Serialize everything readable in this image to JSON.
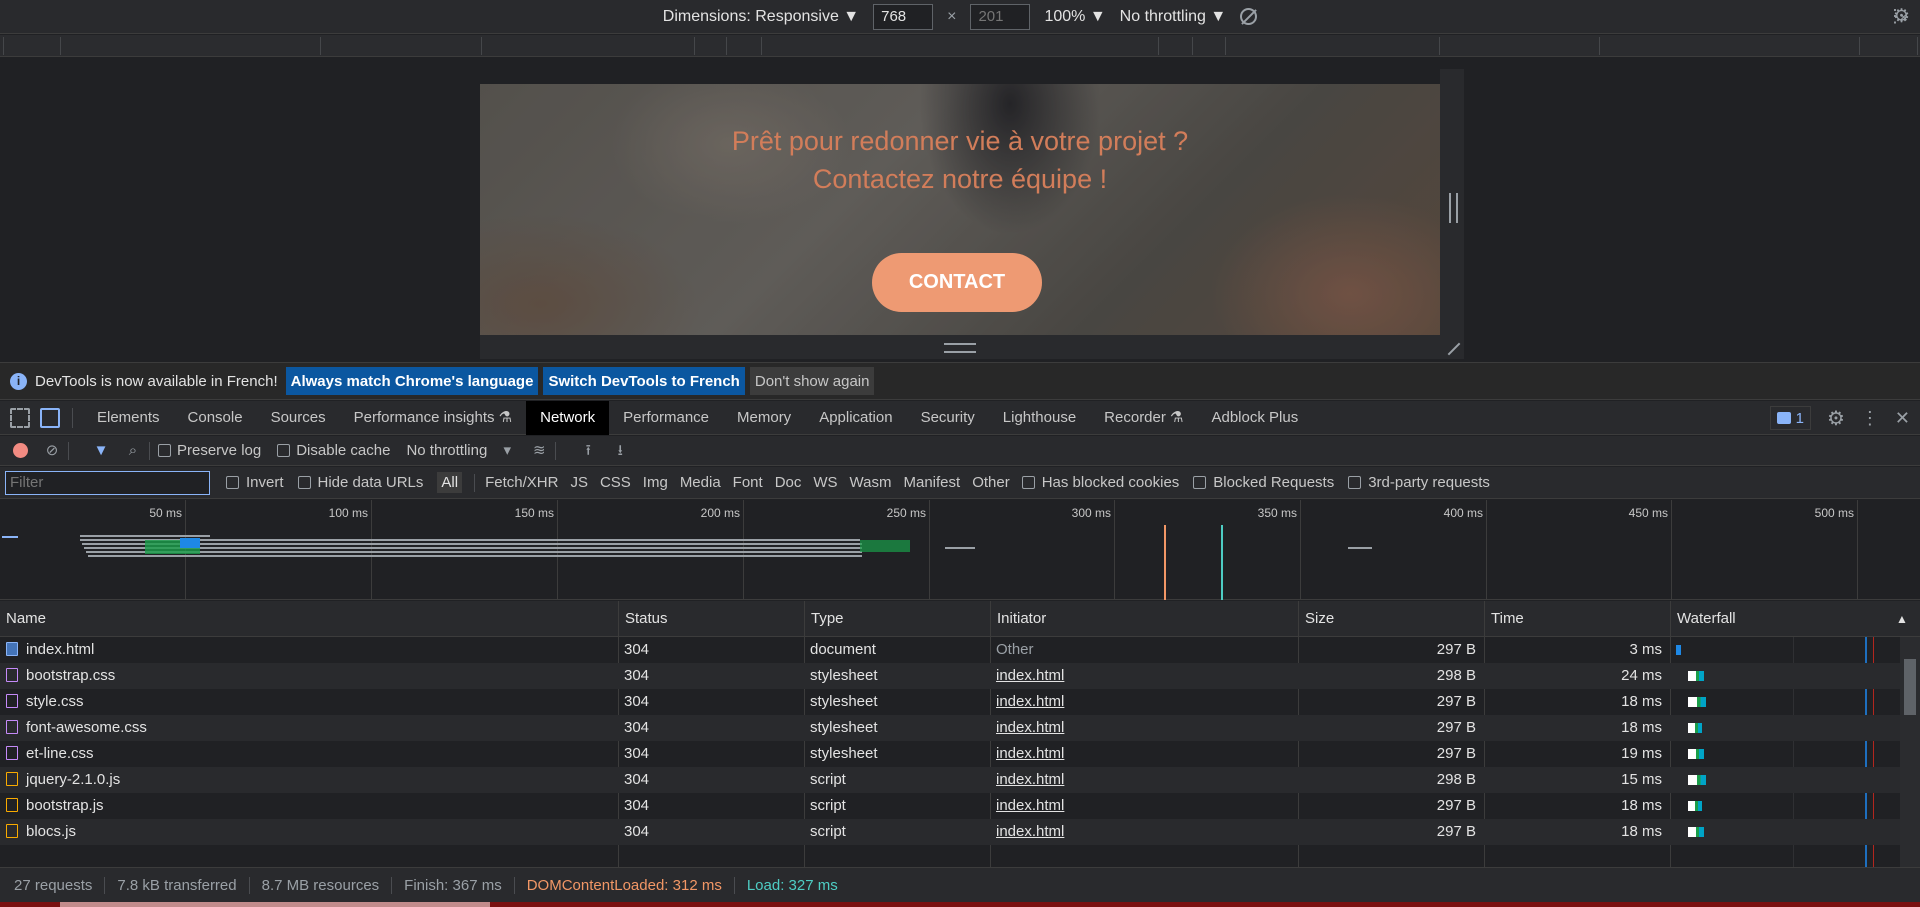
{
  "device_toolbar": {
    "dimensions_label": "Dimensions: Responsive ▼",
    "width_value": "768",
    "height_placeholder": "201",
    "times": "×",
    "zoom": "100% ▼",
    "throttling": "No throttling ▼",
    "menu": "⋮"
  },
  "preview": {
    "hero_line1": "Prêt pour redonner vie à votre projet ?",
    "hero_line2": "Contactez notre équipe !",
    "contact_label": "CONTACT"
  },
  "info_bar": {
    "message": "DevTools is now available in French!",
    "btn_match": "Always match Chrome's language",
    "btn_switch": "Switch DevTools to French",
    "btn_dont_show": "Don't show again",
    "close": "×"
  },
  "tabs": {
    "items": [
      "Elements",
      "Console",
      "Sources",
      "Performance insights ⚗",
      "Network",
      "Performance",
      "Memory",
      "Application",
      "Security",
      "Lighthouse",
      "Recorder ⚗",
      "Adblock Plus"
    ],
    "active": "Network",
    "messages_count": "1",
    "menu": "⋮",
    "close": "✕"
  },
  "network_toolbar": {
    "preserve_log": "Preserve log",
    "disable_cache": "Disable cache",
    "throttling": "No throttling"
  },
  "filter_bar": {
    "placeholder": "Filter",
    "invert": "Invert",
    "hide_data_urls": "Hide data URLs",
    "types": [
      "All",
      "Fetch/XHR",
      "JS",
      "CSS",
      "Img",
      "Media",
      "Font",
      "Doc",
      "WS",
      "Wasm",
      "Manifest",
      "Other"
    ],
    "has_blocked_cookies": "Has blocked cookies",
    "blocked_requests": "Blocked Requests",
    "third_party": "3rd-party requests"
  },
  "overview": {
    "ticks": [
      "50 ms",
      "100 ms",
      "150 ms",
      "200 ms",
      "250 ms",
      "300 ms",
      "350 ms",
      "400 ms",
      "450 ms",
      "500 ms"
    ]
  },
  "table": {
    "headers": [
      "Name",
      "Status",
      "Type",
      "Initiator",
      "Size",
      "Time",
      "Waterfall"
    ],
    "sort_indicator": "▲",
    "rows": [
      {
        "name": "index.html",
        "status": "304",
        "type": "document",
        "initiator": "Other",
        "size": "297 B",
        "time": "3 ms"
      },
      {
        "name": "bootstrap.css",
        "status": "304",
        "type": "stylesheet",
        "initiator": "index.html",
        "size": "298 B",
        "time": "24 ms"
      },
      {
        "name": "style.css",
        "status": "304",
        "type": "stylesheet",
        "initiator": "index.html",
        "size": "297 B",
        "time": "18 ms"
      },
      {
        "name": "font-awesome.css",
        "status": "304",
        "type": "stylesheet",
        "initiator": "index.html",
        "size": "297 B",
        "time": "18 ms"
      },
      {
        "name": "et-line.css",
        "status": "304",
        "type": "stylesheet",
        "initiator": "index.html",
        "size": "297 B",
        "time": "19 ms"
      },
      {
        "name": "jquery-2.1.0.js",
        "status": "304",
        "type": "script",
        "initiator": "index.html",
        "size": "298 B",
        "time": "15 ms"
      },
      {
        "name": "bootstrap.js",
        "status": "304",
        "type": "script",
        "initiator": "index.html",
        "size": "297 B",
        "time": "18 ms"
      },
      {
        "name": "blocs.js",
        "status": "304",
        "type": "script",
        "initiator": "index.html",
        "size": "297 B",
        "time": "18 ms"
      }
    ]
  },
  "status_bar": {
    "requests": "27 requests",
    "transferred": "7.8 kB transferred",
    "resources": "8.7 MB resources",
    "finish": "Finish: 367 ms",
    "dom_content_loaded": "DOMContentLoaded: 312 ms",
    "load": "Load: 327 ms"
  },
  "colors": {
    "accent": "#8ab4f8",
    "dcl": "#f29766",
    "load": "#4ecdc4",
    "contact_button": "#ee9a73",
    "hero_text": "#d27d5a"
  }
}
